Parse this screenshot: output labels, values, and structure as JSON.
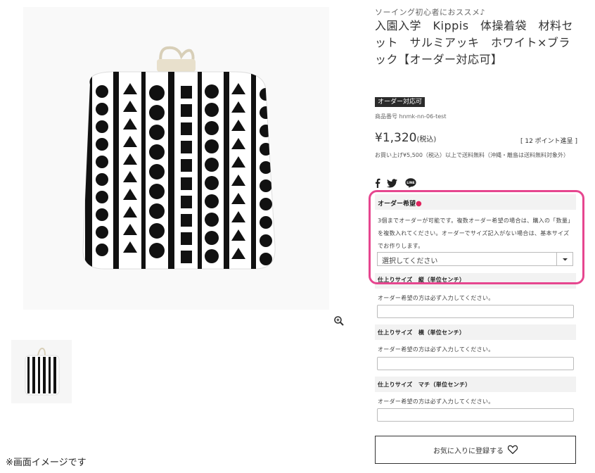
{
  "product": {
    "catch_copy": "ソーイング初心者におススメ♪",
    "title": "入園入学　Kippis　体操着袋　材料セット　サルミアッキ　ホワイト×ブラック【オーダー対応可】",
    "badge": "オーダー対応可",
    "code": "商品番号 hnmk-nn-06-test",
    "price": "¥1,320",
    "price_tax": "(税込)",
    "points": "[ 12 ポイント進呈 ]",
    "shipping_note": "お買い上げ¥5,500（税込）以上で送料無料（沖縄・離島は送料無料対象外）"
  },
  "images": {
    "note": "※画面イメージです"
  },
  "icons": {
    "zoom": "magnifier-plus-icon",
    "facebook": "facebook-icon",
    "twitter": "twitter-icon",
    "line": "line-icon",
    "heart": "heart-icon"
  },
  "order": {
    "label": "オーダー希望",
    "required_mark": "●",
    "description": "3個までオーダーが可能です。複数オーダー希望の場合は、購入の「数量」を複数入れてください。オーダーでサイズ記入がない場合は、基本サイズでお作りします。",
    "select_value": "選択してください"
  },
  "size_fields": [
    {
      "label": "仕上りサイズ　縦（単位センチ）",
      "note": "オーダー希望の方は必ず入力してください。"
    },
    {
      "label": "仕上りサイズ　横（単位センチ）",
      "note": "オーダー希望の方は必ず入力してください。"
    },
    {
      "label": "仕上りサイズ　マチ（単位センチ）",
      "note": "オーダー希望の方は必ず入力してください。"
    }
  ],
  "favorite": {
    "label": "お気に入りに登録する"
  },
  "colors": {
    "highlight": "#e6468f",
    "required": "#e0245e",
    "badge_bg": "#2b2b2b"
  }
}
